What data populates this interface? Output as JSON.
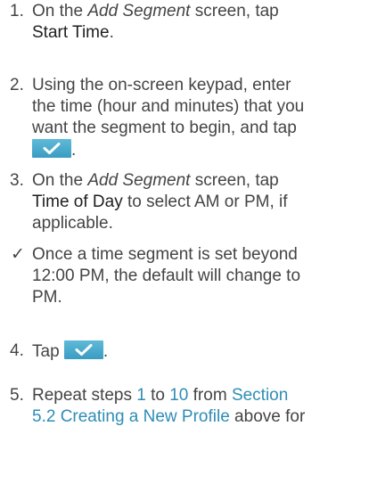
{
  "steps": [
    {
      "num": "1.",
      "before": "On the ",
      "screen": "Add Segment",
      "middle": " screen, tap",
      "action": "Start Time",
      "after": "."
    },
    {
      "num": "2.",
      "line1": "Using the on-screen keypad, enter",
      "line2": "the time (hour and minutes) that you",
      "line3": "want the segment to begin, and tap",
      "after": "."
    },
    {
      "num": "3.",
      "before": "On the ",
      "screen": "Add Segment",
      "middle": " screen, tap",
      "action": "Time of Day",
      "after_line": " to select AM or PM, if",
      "line3": "applicable."
    },
    {
      "num": "4.",
      "text": "Tap",
      "after": "."
    },
    {
      "num": "5.",
      "before": "Repeat steps ",
      "link1": "1",
      "to": " to ",
      "link2": "10",
      "from": " from ",
      "link3": "Section",
      "link4": "5.2 Creating a New Profile",
      "after": " above for"
    }
  ],
  "note": {
    "mark": "✓",
    "line1": "Once a time segment is set beyond",
    "line2": "12:00 PM, the default will change to",
    "line3": "PM."
  },
  "icons": {
    "confirm": "check-button-icon"
  },
  "colors": {
    "text": "#444444",
    "link": "#2e8db5",
    "button": "#3a9cc2"
  }
}
